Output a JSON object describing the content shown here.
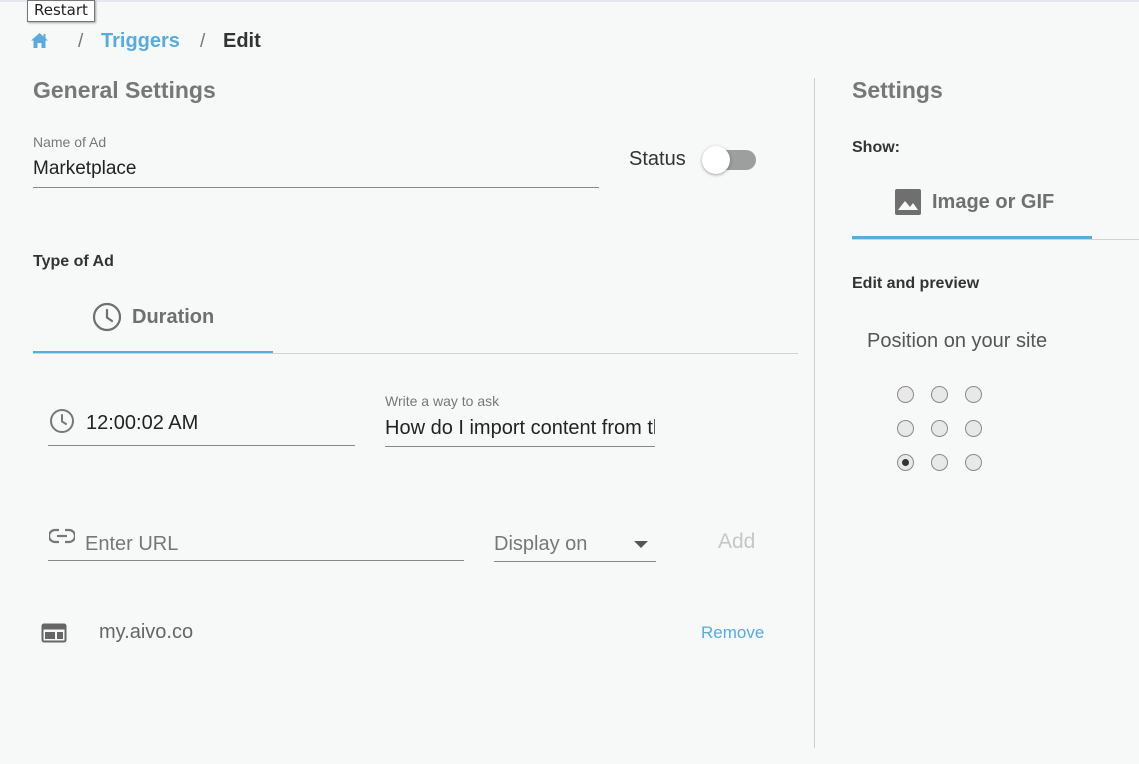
{
  "tooltip": {
    "text": "Restart"
  },
  "breadcrumb": {
    "home_icon": "home-icon",
    "separator": "/",
    "items": [
      {
        "label": "Triggers"
      },
      {
        "label": "Edit"
      }
    ]
  },
  "general": {
    "title": "General Settings",
    "name_label": "Name of Ad",
    "name_value": "Marketplace",
    "status_label": "Status",
    "status_on": false,
    "type_label": "Type of Ad",
    "tabs": [
      {
        "label": "Duration",
        "icon": "clock-icon",
        "active": true
      }
    ],
    "time_value": "12:00:02 AM",
    "ask_label": "Write a way to ask",
    "ask_value": "How do I import content from the",
    "url_placeholder": "Enter URL",
    "display_on": "Display on",
    "add_label": "Add",
    "domains": [
      {
        "name": "my.aivo.co",
        "remove_label": "Remove"
      }
    ]
  },
  "settings": {
    "title": "Settings",
    "show_label": "Show:",
    "tabs": [
      {
        "label": "Image or GIF",
        "icon": "image-icon",
        "active": true
      }
    ],
    "edit_preview_label": "Edit and preview",
    "position_label": "Position on your site",
    "position_selected": "bottom-left"
  },
  "colors": {
    "accent": "#5aaadc",
    "heading": "#777777",
    "background": "#f7f9f9"
  }
}
